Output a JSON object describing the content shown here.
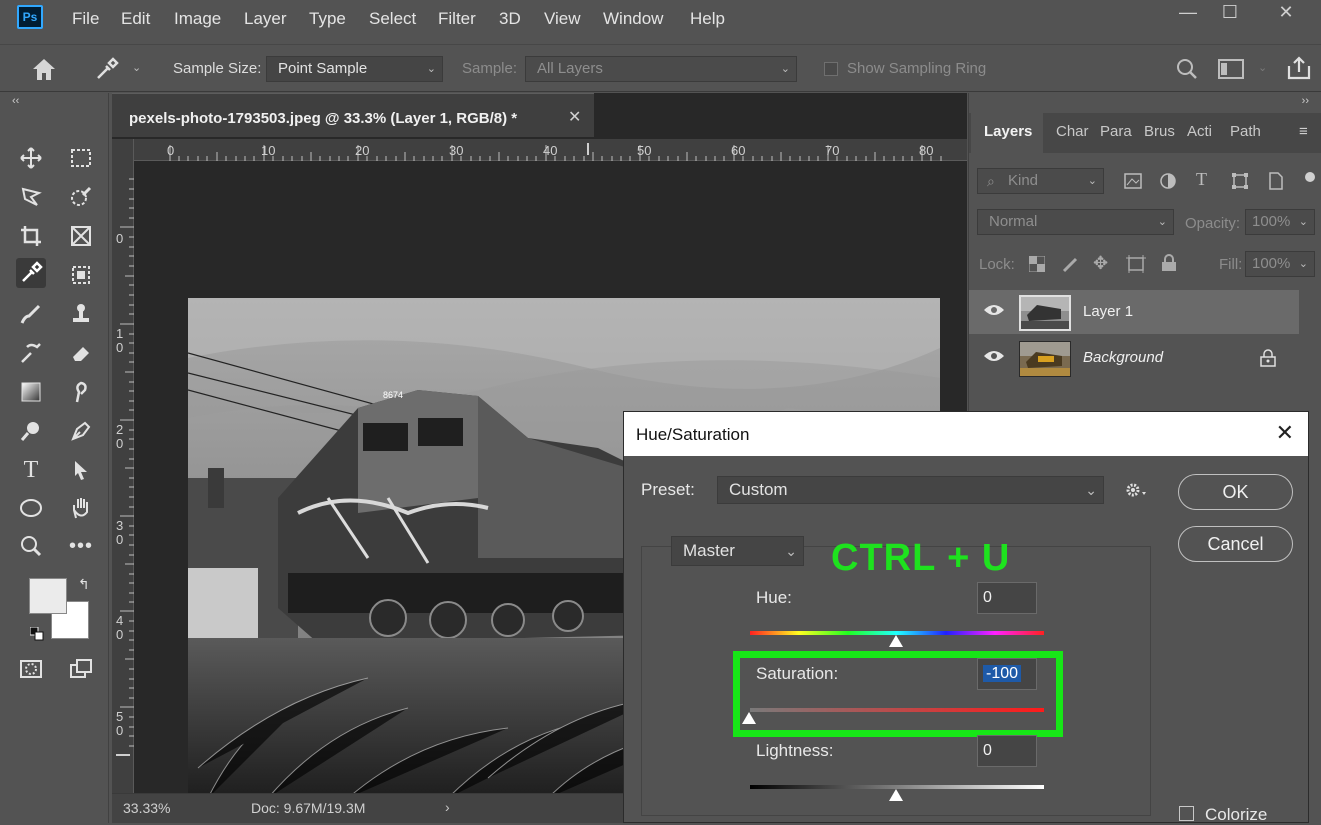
{
  "app": {
    "logo": "Ps"
  },
  "menu": [
    "File",
    "Edit",
    "Image",
    "Layer",
    "Type",
    "Select",
    "Filter",
    "3D",
    "View",
    "Window",
    "Help"
  ],
  "window_controls": {
    "minimize": "—",
    "maximize": "☐",
    "close": "✕"
  },
  "options_bar": {
    "sample_size_label": "Sample Size:",
    "sample_size_value": "Point Sample",
    "sample_label": "Sample:",
    "sample_value": "All Layers",
    "sampling_ring_label": "Show Sampling Ring"
  },
  "document": {
    "tab_title": "pexels-photo-1793503.jpeg @ 33.3% (Layer 1, RGB/8) *",
    "close": "✕",
    "ruler_h": [
      "0",
      "10",
      "20",
      "30",
      "40",
      "50",
      "60",
      "70",
      "80"
    ],
    "ruler_v": [
      "0",
      "1\n0",
      "2\n0",
      "3\n0",
      "4\n0",
      "5\n0"
    ],
    "zoom": "33.33%",
    "doc_size": "Doc: 9.67M/19.3M",
    "locomotive_number": "8674"
  },
  "panels": {
    "tabs": [
      "Layers",
      "Char",
      "Para",
      "Brus",
      "Acti",
      "Path"
    ],
    "filter_kind": "Kind",
    "blend_mode": "Normal",
    "opacity_label": "Opacity:",
    "opacity_value": "100%",
    "lock_label": "Lock:",
    "fill_label": "Fill:",
    "fill_value": "100%",
    "layers": [
      {
        "name": "Layer 1",
        "selected": true
      },
      {
        "name": "Background",
        "selected": false,
        "locked": true
      }
    ]
  },
  "dialog": {
    "title": "Hue/Saturation",
    "close": "✕",
    "preset_label": "Preset:",
    "preset_value": "Custom",
    "channel": "Master",
    "hue_label": "Hue:",
    "hue_value": "0",
    "saturation_label": "Saturation:",
    "saturation_value": "-100",
    "lightness_label": "Lightness:",
    "lightness_value": "0",
    "ok_label": "OK",
    "cancel_label": "Cancel",
    "colorize_label": "Colorize",
    "hotkey_annotation": "CTRL + U",
    "highlight_color": "#17e617"
  }
}
